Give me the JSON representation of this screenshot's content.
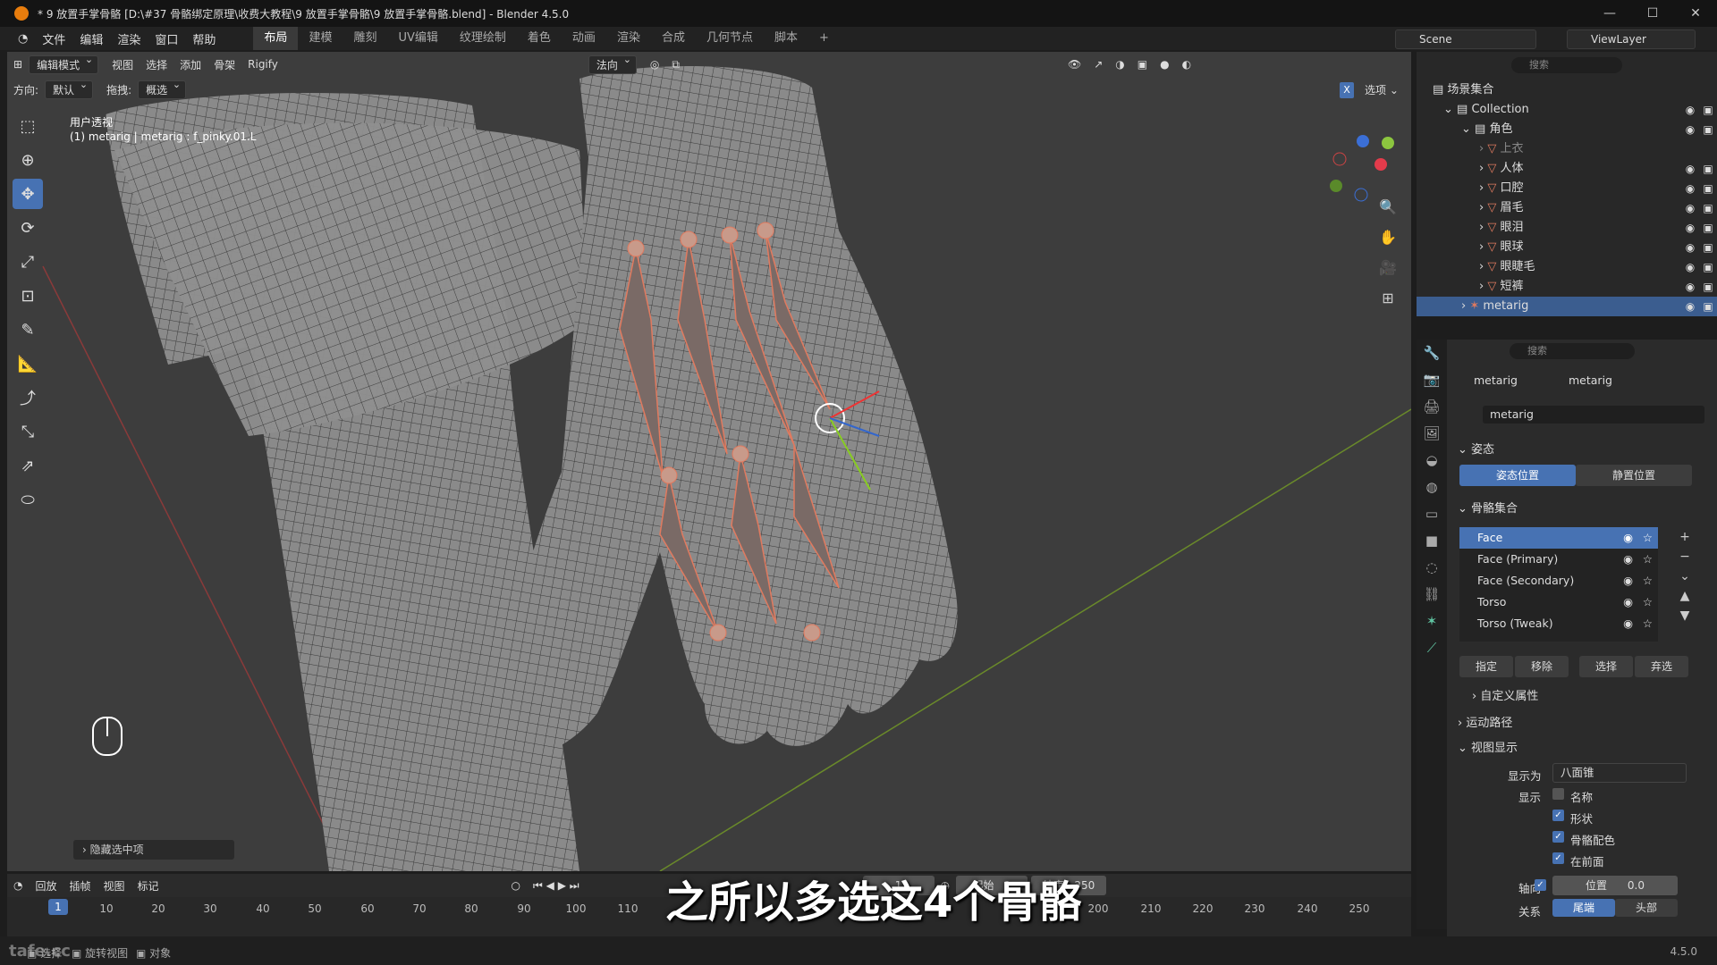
{
  "window": {
    "title": "* 9 放置手掌骨骼 [D:\\#37 骨骼绑定原理\\收费大教程\\9 放置手掌骨骼\\9 放置手掌骨骼.blend] - Blender 4.5.0",
    "minimize": "—",
    "maximize": "☐",
    "close": "✕"
  },
  "menu": {
    "items": [
      "文件",
      "编辑",
      "渲染",
      "窗口",
      "帮助"
    ],
    "workspaces": [
      "布局",
      "建模",
      "雕刻",
      "UV编辑",
      "纹理绘制",
      "着色",
      "动画",
      "渲染",
      "合成",
      "几何节点",
      "脚本"
    ],
    "add_tab": "+",
    "scene": "Scene",
    "view_layer": "ViewLayer"
  },
  "viewport_header": {
    "mode": "编辑模式",
    "menus": [
      "视图",
      "选择",
      "添加",
      "骨架",
      "Rigify"
    ],
    "transform_orientation": "法向",
    "options": "选项",
    "x_toggle": "X"
  },
  "viewport_subheader": {
    "direction_label": "方向:",
    "direction_value": "默认",
    "drag_label": "拖拽:",
    "drag_value": "概选"
  },
  "viewport": {
    "view_name": "用户透视",
    "active_object": "(1) metarig | metarig : f_pinky.01.L",
    "hidden_items": "隐藏选中项",
    "gizmo_axes": [
      "X",
      "Y",
      "Z"
    ]
  },
  "outliner": {
    "search_placeholder": "搜索",
    "root": "场景集合",
    "collection": "Collection",
    "character": "角色",
    "objects": [
      "上衣",
      "人体",
      "口腔",
      "眉毛",
      "眼泪",
      "眼球",
      "眼睫毛",
      "短裤"
    ],
    "armature": "metarig"
  },
  "properties": {
    "search_placeholder": "搜索",
    "breadcrumb": [
      "metarig",
      "metarig"
    ],
    "data_name": "metarig",
    "pose_section": "姿态",
    "pose_position": "姿态位置",
    "rest_position": "静置位置",
    "bone_collections_section": "骨骼集合",
    "bone_collections": [
      "Face",
      "Face (Primary)",
      "Face (Secondary)",
      "Torso",
      "Torso (Tweak)"
    ],
    "assign": "指定",
    "remove": "移除",
    "select": "选择",
    "deselect": "弃选",
    "custom_props": "自定义属性",
    "motion_paths": "运动路径",
    "viewport_display": "视图显示",
    "display_as_label": "显示为",
    "display_as_value": "八面锥",
    "show_label": "显示",
    "show_names": "名称",
    "show_shapes": "形状",
    "show_bone_colors": "骨骼配色",
    "in_front": "在前面",
    "axes_label": "轴向",
    "position_label": "位置",
    "position_value": "0.0",
    "relation_label": "关系",
    "relation_tail": "尾端",
    "relation_head": "头部"
  },
  "timeline": {
    "menus": [
      "回放",
      "插帧",
      "视图",
      "标记"
    ],
    "current_frame": "1",
    "start_label": "起始",
    "start_value": "1",
    "end_label": "结束",
    "end_value": "250",
    "ticks": [
      "10",
      "20",
      "30",
      "40",
      "50",
      "60",
      "70",
      "80",
      "90",
      "100",
      "110",
      "200",
      "210",
      "220",
      "230",
      "240",
      "250"
    ],
    "playhead": "1"
  },
  "statusbar": {
    "items": [
      "选择",
      "旋转视图",
      "对象"
    ],
    "version": "4.5.0",
    "watermark": "tafe.cc"
  },
  "subtitle": "之所以多选这4个骨骼"
}
